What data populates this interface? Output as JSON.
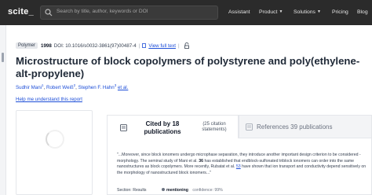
{
  "nav": {
    "logo": "scite_",
    "search_placeholder": "Search by title, author, keywords or DOI",
    "assistant": "Assistant",
    "product": "Product",
    "solutions": "Solutions",
    "pricing": "Pricing",
    "blog": "Blog"
  },
  "paper": {
    "type_badge": "Polymer",
    "year": "1998",
    "doi": "DOI: 10.1016/s0032-3861(97)00487-4",
    "full_text_link": "View full text",
    "title": "Microstructure of block copolymers of polystyrene and poly(ethylene-alt-propylene)",
    "authors": [
      {
        "name": "Sudhir Mani",
        "sup": "1"
      },
      {
        "name": "Robert Weiß",
        "sup": "2"
      },
      {
        "name": "Stephen F. Hahn",
        "sup": "3"
      }
    ],
    "et_al": "et al.",
    "help_link": "Help me understand this report"
  },
  "citations": {
    "cited_by_label": "Cited by 18 publications",
    "cited_count": "(25 citation statements)",
    "references_label": "References 39 publications"
  },
  "statement": {
    "text_pre": "\"...Moreover, since block ionomers undergo microphase separation, they introduce another important design criterion to be considered -morphology. The seminal study of Mani et al.",
    "ref_num_1": "36",
    "text_mid": "has established that endblock-sulfonated triblock ionomers can order into the same nanostructures as block copolymers. More recently, Rubatat et al.",
    "ref_num_2": "53",
    "text_post": "have shown that ion transport and conductivity depend sensitively on the morphology of nanostructured block ionomers...\"",
    "section_label": "Section:",
    "section_value": "Results",
    "mention": "mentioning",
    "confidence": "confidence: 99%"
  },
  "colors": {
    "nav_bg": "#2b2b2b",
    "link": "#1d4ed8"
  }
}
